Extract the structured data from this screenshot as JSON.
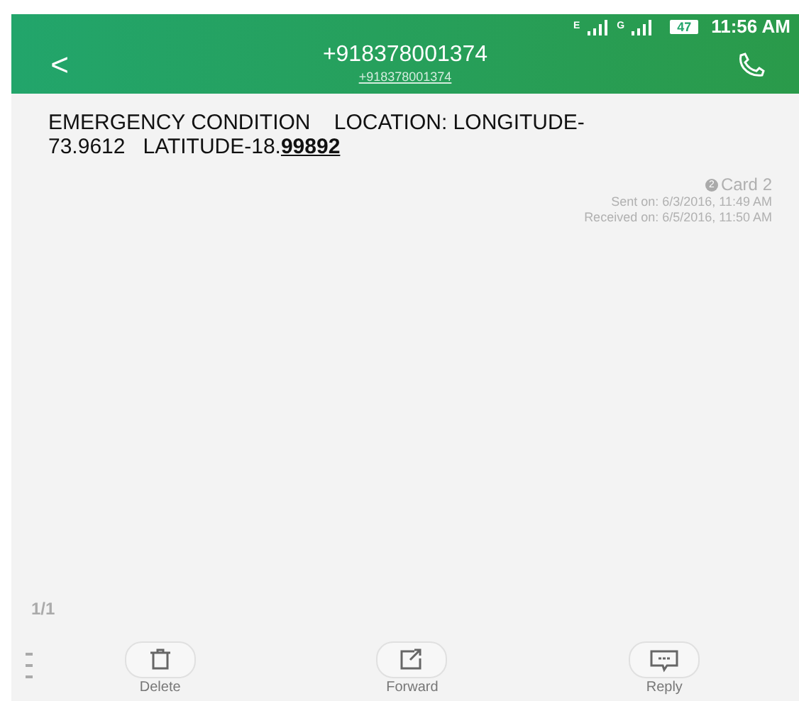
{
  "status_bar": {
    "network_1": "E",
    "network_2": "G",
    "battery": "47",
    "time": "11:56 AM"
  },
  "header": {
    "back": "<",
    "title": "+918378001374",
    "subtitle": "+918378001374"
  },
  "message": {
    "text": "EMERGENCY CONDITION    LOCATION: LONGITUDE-73.9612   LATITUDE-18.**99892**",
    "sim": "2",
    "card": "Card 2",
    "sent": "Sent on: 6/3/2016, 11:49 AM",
    "received": "Received on: 6/5/2016, 11:50 AM"
  },
  "page_count": "1/1",
  "actions": [
    {
      "kind": "delete",
      "label": "Delete"
    },
    {
      "kind": "forward",
      "label": "Forward"
    },
    {
      "kind": "reply",
      "label": "Reply"
    }
  ]
}
